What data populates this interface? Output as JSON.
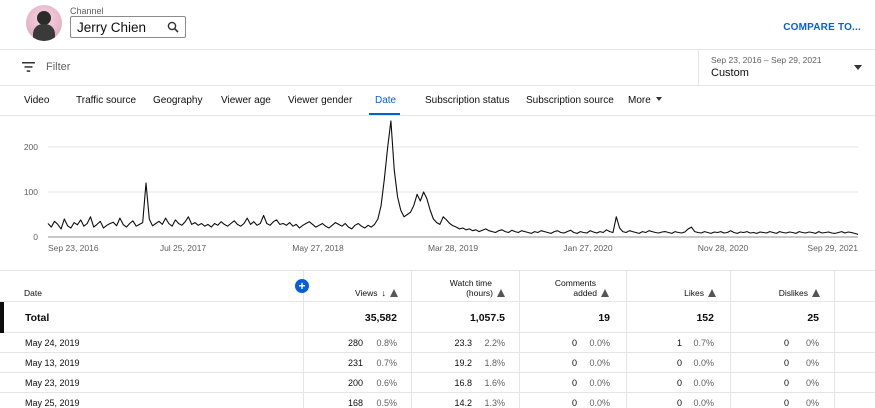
{
  "header": {
    "channel_label": "Channel",
    "channel_name": "Jerry Chien",
    "compare_label": "COMPARE TO..."
  },
  "filter": {
    "placeholder": "Filter",
    "date_range": "Sep 23, 2016 – Sep 29, 2021",
    "date_preset": "Custom"
  },
  "tabs": [
    {
      "label": "Video",
      "active": false
    },
    {
      "label": "Traffic source",
      "active": false
    },
    {
      "label": "Geography",
      "active": false
    },
    {
      "label": "Viewer age",
      "active": false
    },
    {
      "label": "Viewer gender",
      "active": false
    },
    {
      "label": "Date",
      "active": true
    },
    {
      "label": "Subscription status",
      "active": false
    },
    {
      "label": "Subscription source",
      "active": false
    },
    {
      "label": "More",
      "active": false
    }
  ],
  "colors": {
    "accent": "#065fd4",
    "text": "#0d0d0d",
    "secondary": "#606060",
    "divider": "#e5e5e5"
  },
  "chart_data": {
    "type": "line",
    "title": "",
    "xlabel": "",
    "ylabel": "",
    "x_ticks": [
      "Sep 23, 2016",
      "Jul 25, 2017",
      "May 27, 2018",
      "Mar 28, 2019",
      "Jan 27, 2020",
      "Nov 28, 2020",
      "Sep 29, 2021"
    ],
    "y_ticks": [
      0,
      100,
      200
    ],
    "ylim": [
      0,
      260
    ],
    "grid": true,
    "legend": "none",
    "series": [
      {
        "values": [
          30,
          22,
          35,
          28,
          18,
          40,
          25,
          20,
          32,
          27,
          38,
          24,
          30,
          45,
          22,
          28,
          35,
          20,
          26,
          30,
          33,
          25,
          42,
          28,
          22,
          30,
          36,
          24,
          28,
          32,
          120,
          40,
          25,
          30,
          35,
          28,
          42,
          30,
          24,
          38,
          30,
          26,
          34,
          45,
          28,
          32,
          26,
          30,
          24,
          28,
          22,
          30,
          26,
          34,
          28,
          24,
          30,
          36,
          28,
          24,
          30,
          42,
          28,
          34,
          26,
          30,
          48,
          30,
          26,
          34,
          38,
          28,
          30,
          26,
          32,
          24,
          28,
          20,
          26,
          30,
          34,
          28,
          22,
          26,
          30,
          24,
          20,
          26,
          32,
          28,
          24,
          30,
          22,
          18,
          26,
          30,
          24,
          20,
          26,
          22,
          28,
          40,
          70,
          130,
          200,
          258,
          150,
          90,
          60,
          45,
          50,
          55,
          70,
          95,
          80,
          100,
          85,
          60,
          40,
          32,
          28,
          45,
          38,
          30,
          25,
          22,
          18,
          20,
          16,
          18,
          14,
          16,
          12,
          15,
          18,
          14,
          12,
          10,
          14,
          16,
          12,
          10,
          15,
          12,
          10,
          14,
          12,
          10,
          8,
          12,
          10,
          14,
          12,
          10,
          8,
          12,
          14,
          10,
          9,
          12,
          15,
          10,
          8,
          12,
          10,
          9,
          14,
          11,
          9,
          12,
          10,
          16,
          12,
          10,
          45,
          20,
          12,
          10,
          14,
          12,
          10,
          8,
          12,
          10,
          14,
          12,
          10,
          9,
          11,
          12,
          10,
          8,
          12,
          10,
          9,
          11,
          18,
          22,
          12,
          10,
          9,
          12,
          10,
          8,
          11,
          10,
          12,
          9,
          10,
          14,
          10,
          8,
          11,
          10,
          12,
          9,
          10,
          8,
          11,
          10,
          9,
          12,
          10,
          8,
          12,
          10,
          9,
          11,
          10,
          8,
          12,
          10,
          9,
          11,
          10,
          8,
          12,
          9,
          10,
          11,
          9,
          8,
          10,
          12,
          9,
          11,
          10,
          8,
          6
        ]
      }
    ]
  },
  "table": {
    "headers": {
      "date": "Date",
      "views": "Views",
      "watch_time": [
        "Watch time",
        "(hours)"
      ],
      "comments": [
        "Comments",
        "added"
      ],
      "likes": "Likes",
      "dislikes": "Dislikes"
    },
    "total": {
      "label": "Total",
      "views": "35,582",
      "watch_time": "1,057.5",
      "comments": "19",
      "likes": "152",
      "dislikes": "25"
    },
    "rows": [
      {
        "date": "May 24, 2019",
        "views": "280",
        "views_pct": "0.8%",
        "watch": "23.3",
        "watch_pct": "2.2%",
        "comments": "0",
        "comments_pct": "0.0%",
        "likes": "1",
        "likes_pct": "0.7%",
        "dislikes": "0",
        "dislikes_pct": "0%"
      },
      {
        "date": "May 13, 2019",
        "views": "231",
        "views_pct": "0.7%",
        "watch": "19.2",
        "watch_pct": "1.8%",
        "comments": "0",
        "comments_pct": "0.0%",
        "likes": "0",
        "likes_pct": "0.0%",
        "dislikes": "0",
        "dislikes_pct": "0%"
      },
      {
        "date": "May 23, 2019",
        "views": "200",
        "views_pct": "0.6%",
        "watch": "16.8",
        "watch_pct": "1.6%",
        "comments": "0",
        "comments_pct": "0.0%",
        "likes": "0",
        "likes_pct": "0.0%",
        "dislikes": "0",
        "dislikes_pct": "0%"
      },
      {
        "date": "May 25, 2019",
        "views": "168",
        "views_pct": "0.5%",
        "watch": "14.2",
        "watch_pct": "1.3%",
        "comments": "0",
        "comments_pct": "0.0%",
        "likes": "0",
        "likes_pct": "0.0%",
        "dislikes": "0",
        "dislikes_pct": "0%"
      }
    ]
  }
}
